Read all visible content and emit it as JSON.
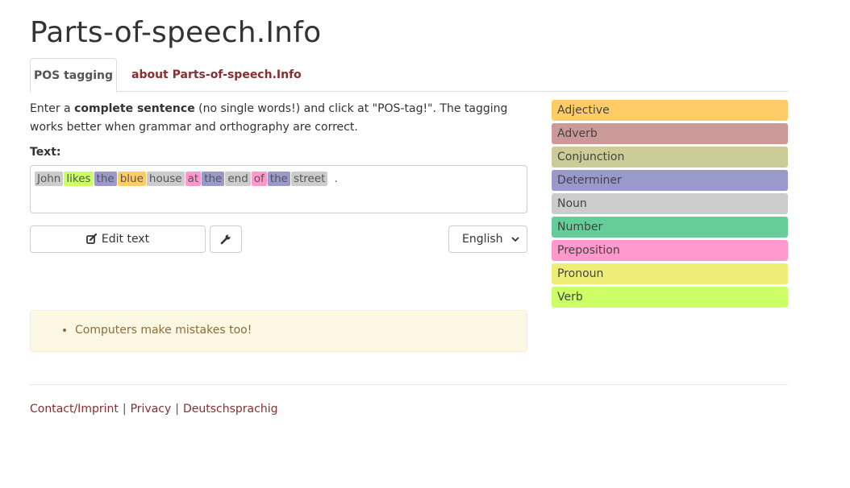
{
  "page": {
    "title": "Parts-of-speech.Info"
  },
  "tabs": [
    {
      "label": "POS tagging",
      "active": true
    },
    {
      "label": "about Parts-of-speech.Info",
      "active": false
    }
  ],
  "intro": {
    "part1": "Enter a ",
    "bold": "complete sentence",
    "part2": " (no single words!) and click at \"POS-tag!\". The tagging works better when grammar and orthography are correct."
  },
  "text_label": "Text:",
  "tokens": [
    {
      "word": "John",
      "pos": "Noun"
    },
    {
      "word": "likes",
      "pos": "Verb"
    },
    {
      "word": "the",
      "pos": "Determiner"
    },
    {
      "word": "blue",
      "pos": "Adjective"
    },
    {
      "word": "house",
      "pos": "Noun"
    },
    {
      "word": "at",
      "pos": "Preposition"
    },
    {
      "word": "the",
      "pos": "Determiner"
    },
    {
      "word": "end",
      "pos": "Noun"
    },
    {
      "word": "of",
      "pos": "Preposition"
    },
    {
      "word": "the",
      "pos": "Determiner"
    },
    {
      "word": "street",
      "pos": "Noun"
    },
    {
      "word": ".",
      "pos": null
    }
  ],
  "buttons": {
    "edit_label": "Edit text",
    "edit_icon": "edit-icon",
    "settings_icon": "wrench-icon"
  },
  "language": {
    "selected": "English"
  },
  "alert": {
    "items": [
      "Computers make mistakes too!"
    ]
  },
  "legend": [
    {
      "label": "Adjective",
      "color": "#ffcc66"
    },
    {
      "label": "Adverb",
      "color": "#cc9999"
    },
    {
      "label": "Conjunction",
      "color": "#cccc99"
    },
    {
      "label": "Determiner",
      "color": "#9999cc"
    },
    {
      "label": "Noun",
      "color": "#cccccc"
    },
    {
      "label": "Number",
      "color": "#66cc99"
    },
    {
      "label": "Preposition",
      "color": "#ff99cc"
    },
    {
      "label": "Pronoun",
      "color": "#eeee77"
    },
    {
      "label": "Verb",
      "color": "#ccff66"
    }
  ],
  "footer": {
    "links": [
      "Contact/Imprint",
      "Privacy",
      "Deutschsprachig"
    ],
    "separator": "|"
  }
}
